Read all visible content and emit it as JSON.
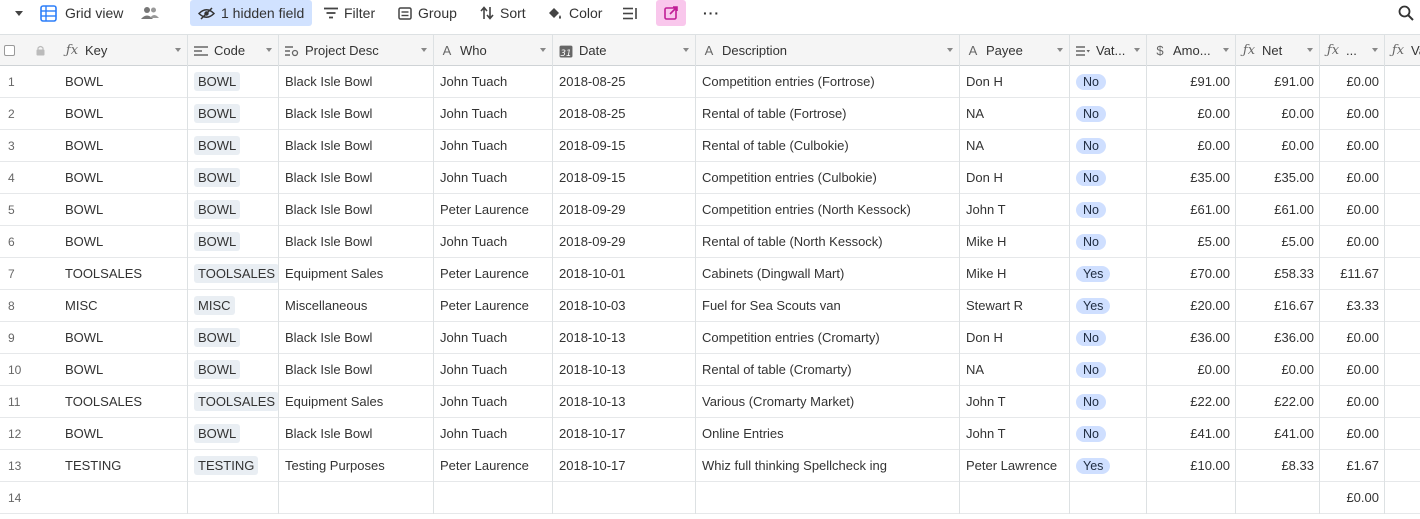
{
  "toolbar": {
    "view_name": "Grid view",
    "hidden_fields_label": "1 hidden field",
    "filter_label": "Filter",
    "group_label": "Group",
    "sort_label": "Sort",
    "color_label": "Color",
    "more_label": "···"
  },
  "columns": [
    {
      "key": "key",
      "label": "Key",
      "icon": "formula-icon"
    },
    {
      "key": "code",
      "label": "Code",
      "icon": "link-icon"
    },
    {
      "key": "project",
      "label": "Project Desc",
      "icon": "lookup-icon"
    },
    {
      "key": "who",
      "label": "Who",
      "icon": "text-icon"
    },
    {
      "key": "date",
      "label": "Date",
      "icon": "calendar-icon"
    },
    {
      "key": "description",
      "label": "Description",
      "icon": "text-icon"
    },
    {
      "key": "payee",
      "label": "Payee",
      "icon": "text-icon"
    },
    {
      "key": "vat",
      "label": "Vat...",
      "icon": "single-select-icon"
    },
    {
      "key": "amount",
      "label": "Amo...",
      "icon": "currency-icon"
    },
    {
      "key": "net",
      "label": "Net",
      "icon": "formula-icon"
    },
    {
      "key": "vatamt",
      "label": "...",
      "icon": "formula-icon"
    },
    {
      "key": "extra",
      "label": "Va",
      "icon": "formula-icon"
    }
  ],
  "rows": [
    {
      "n": "1",
      "key": "BOWL",
      "code": "BOWL",
      "project": "Black Isle Bowl",
      "who": "John Tuach",
      "date": "2018-08-25",
      "description": "Competition entries (Fortrose)",
      "payee": "Don H",
      "vat": "No",
      "amount": "£91.00",
      "net": "£91.00",
      "vatamt": "£0.00"
    },
    {
      "n": "2",
      "key": "BOWL",
      "code": "BOWL",
      "project": "Black Isle Bowl",
      "who": "John Tuach",
      "date": "2018-08-25",
      "description": "Rental of table (Fortrose)",
      "payee": "NA",
      "vat": "No",
      "amount": "£0.00",
      "net": "£0.00",
      "vatamt": "£0.00"
    },
    {
      "n": "3",
      "key": "BOWL",
      "code": "BOWL",
      "project": "Black Isle Bowl",
      "who": "John Tuach",
      "date": "2018-09-15",
      "description": "Rental of table (Culbokie)",
      "payee": "NA",
      "vat": "No",
      "amount": "£0.00",
      "net": "£0.00",
      "vatamt": "£0.00"
    },
    {
      "n": "4",
      "key": "BOWL",
      "code": "BOWL",
      "project": "Black Isle Bowl",
      "who": "John Tuach",
      "date": "2018-09-15",
      "description": "Competition entries (Culbokie)",
      "payee": "Don H",
      "vat": "No",
      "amount": "£35.00",
      "net": "£35.00",
      "vatamt": "£0.00"
    },
    {
      "n": "5",
      "key": "BOWL",
      "code": "BOWL",
      "project": "Black Isle Bowl",
      "who": "Peter Laurence",
      "date": "2018-09-29",
      "description": "Competition entries (North Kessock)",
      "payee": "John T",
      "vat": "No",
      "amount": "£61.00",
      "net": "£61.00",
      "vatamt": "£0.00"
    },
    {
      "n": "6",
      "key": "BOWL",
      "code": "BOWL",
      "project": "Black Isle Bowl",
      "who": "John Tuach",
      "date": "2018-09-29",
      "description": "Rental of table (North Kessock)",
      "payee": "Mike H",
      "vat": "No",
      "amount": "£5.00",
      "net": "£5.00",
      "vatamt": "£0.00"
    },
    {
      "n": "7",
      "key": "TOOLSALES",
      "code": "TOOLSALES",
      "project": "Equipment Sales",
      "who": "Peter Laurence",
      "date": "2018-10-01",
      "description": "Cabinets (Dingwall Mart)",
      "payee": "Mike H",
      "vat": "Yes",
      "amount": "£70.00",
      "net": "£58.33",
      "vatamt": "£11.67"
    },
    {
      "n": "8",
      "key": "MISC",
      "code": "MISC",
      "project": "Miscellaneous",
      "who": "Peter Laurence",
      "date": "2018-10-03",
      "description": "Fuel for Sea Scouts van",
      "payee": "Stewart R",
      "vat": "Yes",
      "amount": "£20.00",
      "net": "£16.67",
      "vatamt": "£3.33"
    },
    {
      "n": "9",
      "key": "BOWL",
      "code": "BOWL",
      "project": "Black Isle Bowl",
      "who": "John Tuach",
      "date": "2018-10-13",
      "description": "Competition entries (Cromarty)",
      "payee": "Don H",
      "vat": "No",
      "amount": "£36.00",
      "net": "£36.00",
      "vatamt": "£0.00"
    },
    {
      "n": "10",
      "key": "BOWL",
      "code": "BOWL",
      "project": "Black Isle Bowl",
      "who": "John Tuach",
      "date": "2018-10-13",
      "description": "Rental of table (Cromarty)",
      "payee": "NA",
      "vat": "No",
      "amount": "£0.00",
      "net": "£0.00",
      "vatamt": "£0.00"
    },
    {
      "n": "11",
      "key": "TOOLSALES",
      "code": "TOOLSALES",
      "project": "Equipment Sales",
      "who": "John Tuach",
      "date": "2018-10-13",
      "description": "Various (Cromarty Market)",
      "payee": "John T",
      "vat": "No",
      "amount": "£22.00",
      "net": "£22.00",
      "vatamt": "£0.00"
    },
    {
      "n": "12",
      "key": "BOWL",
      "code": "BOWL",
      "project": "Black Isle Bowl",
      "who": "John Tuach",
      "date": "2018-10-17",
      "description": "Online Entries",
      "payee": "John T",
      "vat": "No",
      "amount": "£41.00",
      "net": "£41.00",
      "vatamt": "£0.00"
    },
    {
      "n": "13",
      "key": "TESTING",
      "code": "TESTING",
      "project": "Testing Purposes",
      "who": "Peter Laurence",
      "date": "2018-10-17",
      "description": "Whiz full thinking Spellcheck ing",
      "payee": "Peter Lawrence",
      "vat": "Yes",
      "amount": "£10.00",
      "net": "£8.33",
      "vatamt": "£1.67"
    },
    {
      "n": "14",
      "key": "",
      "code": "",
      "project": "",
      "who": "",
      "date": "",
      "description": "",
      "payee": "",
      "vat": "",
      "amount": "",
      "net": "",
      "vatamt": "£0.00"
    }
  ],
  "colors": {
    "hidden_field_bg": "#d1e2ff",
    "share_bg": "#f9c7ec",
    "vat_pill_bg": "#cfdfff",
    "code_pill_bg": "#e9eef3",
    "header_bg": "#f5f5f5"
  }
}
